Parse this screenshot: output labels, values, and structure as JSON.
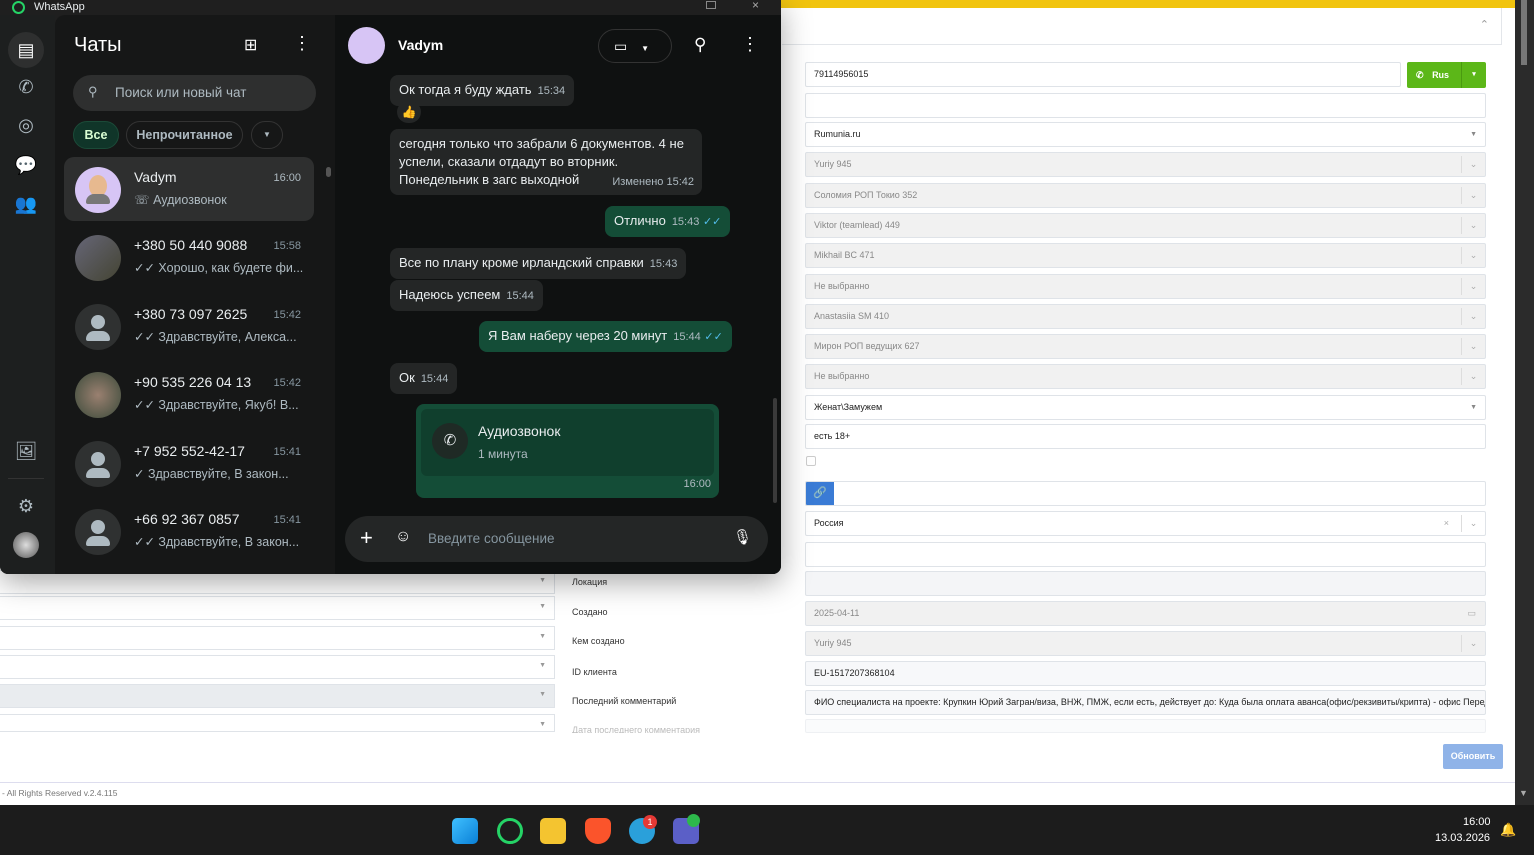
{
  "whatsapp": {
    "app_title": "WhatsApp",
    "list_title": "Чаты",
    "search_placeholder": "Поиск или новый чат",
    "filters": [
      "Все",
      "Непрочитанное"
    ],
    "chats": [
      {
        "name": "Vadym",
        "time": "16:00",
        "preview": "☏ Аудиозвонок"
      },
      {
        "name": "+380 50 440 9088",
        "time": "15:58",
        "preview": "✓✓ Хорошо, как будете фи..."
      },
      {
        "name": "+380 73 097 2625",
        "time": "15:42",
        "preview": "✓✓ Здравствуйте, Алекса..."
      },
      {
        "name": "+90 535 226 04 13",
        "time": "15:42",
        "preview": "✓✓ Здравствуйте, Якуб!  В..."
      },
      {
        "name": "+7 952 552-42-17",
        "time": "15:41",
        "preview": "✓ Здравствуйте,  В закон..."
      },
      {
        "name": "+66 92 367 0857",
        "time": "15:41",
        "preview": "✓✓ Здравствуйте,  В закон..."
      }
    ],
    "contact": "Vadym",
    "messages": [
      {
        "text": "Ок тогда я буду ждать",
        "time": "15:34",
        "reaction": "👍"
      },
      {
        "text": "сегодня только что забрали 6 документов. 4 не успели, сказали отдадут во вторник. Понедельник в загс выходной",
        "time": "Изменено 15:42"
      },
      {
        "text": "Отлично",
        "time": "15:43"
      },
      {
        "text": "Все по плану кроме ирландский справки",
        "time": "15:43"
      },
      {
        "text": "Надеюсь успеем",
        "time": "15:44"
      },
      {
        "text": "Я Вам наберу через 20 минут",
        "time": "15:44"
      },
      {
        "text": "Ок",
        "time": "15:44"
      }
    ],
    "call": {
      "title": "Аудиозвонок",
      "duration": "1 минута",
      "time": "16:00"
    },
    "composer_placeholder": "Введите сообщение"
  },
  "form": {
    "phone": "79114956015",
    "call_button": "Rus",
    "site": "Rumunia.ru",
    "selects": [
      "Yuriy 945",
      "Соломия РОП Токио 352",
      "Viktor (teamlead) 449",
      "Mikhail BC 471",
      "Не выбранно",
      "Anastasiia SM 410",
      "Мирон РОП ведущих 627",
      "Не выбранно"
    ],
    "marital": "Женат\\Замужем",
    "children": "есть 18+",
    "country": "Россия",
    "created": "2025-04-11",
    "created_by": "Yuriy 945",
    "client_id": "EU-1517207368104",
    "last_comment": "ФИО специалиста на проекте: Крупкин Юрий  Загран/виза, ВНЖ, ПМЖ, если есть, действует до: Куда была оплата аванса(офис/рекзивиты/крипта) - офис  Передача н",
    "labels": [
      "Локация",
      "Создано",
      "Кем создано",
      "ID клиента",
      "Последний комментарий",
      "Дата последнего комментария"
    ],
    "update_button": "Обновить",
    "footer": "- All Rights Reserved v.2.4.115"
  },
  "taskbar": {
    "time": "16:00",
    "date": "13.03.2026",
    "telegram_badge": "1"
  }
}
